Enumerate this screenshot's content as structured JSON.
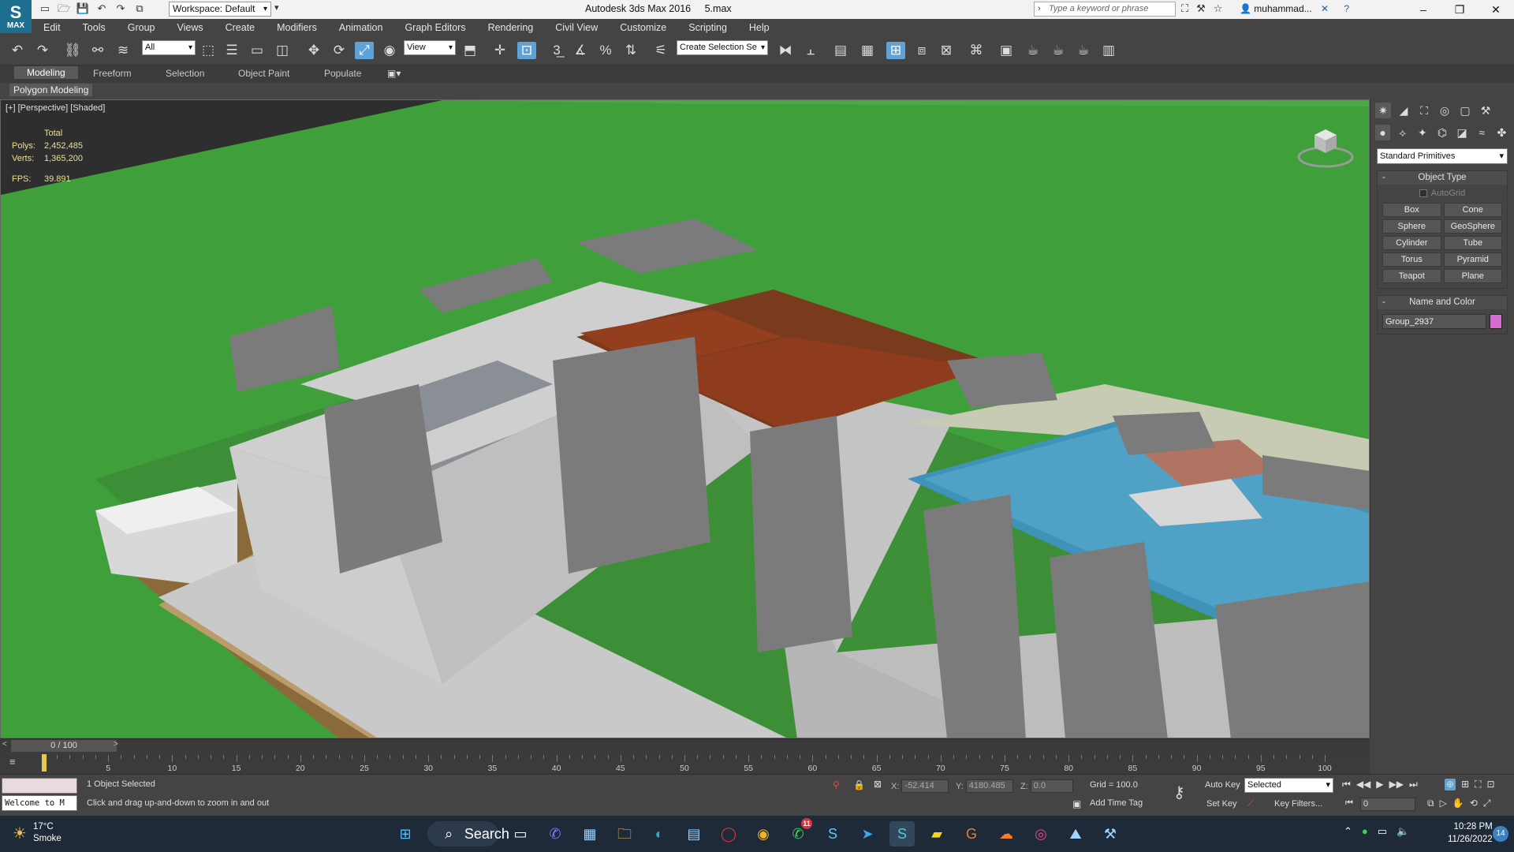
{
  "app": {
    "logo_text": "MAX",
    "workspace": "Workspace: Default",
    "title": "Autodesk 3ds Max 2016",
    "filename": "5.max",
    "search_placeholder": "Type a keyword or phrase",
    "user": "muhammad..."
  },
  "menu": [
    "Edit",
    "Tools",
    "Group",
    "Views",
    "Create",
    "Modifiers",
    "Animation",
    "Graph Editors",
    "Rendering",
    "Civil View",
    "Customize",
    "Scripting",
    "Help"
  ],
  "toolbar": {
    "filter": "All",
    "ref_coord": "View",
    "selection_set": "Create Selection Se"
  },
  "ribbon": {
    "tabs": [
      "Modeling",
      "Freeform",
      "Selection",
      "Object Paint",
      "Populate"
    ],
    "active_tab": "Modeling",
    "subpanel": "Polygon Modeling"
  },
  "viewport": {
    "label": "[+] [Perspective] [Shaded]",
    "stats_header": "Total",
    "polys_label": "Polys:",
    "polys": "2,452,485",
    "verts_label": "Verts:",
    "verts": "1,365,200",
    "fps_label": "FPS:",
    "fps": "39.891"
  },
  "command_panel": {
    "category": "Standard Primitives",
    "object_type_title": "Object Type",
    "autogrid": "AutoGrid",
    "primitives": [
      "Box",
      "Cone",
      "Sphere",
      "GeoSphere",
      "Cylinder",
      "Tube",
      "Torus",
      "Pyramid",
      "Teapot",
      "Plane"
    ],
    "name_color_title": "Name and Color",
    "object_name": "Group_2937",
    "object_color": "#d66bd0"
  },
  "timeline": {
    "frame_display": "0 / 100",
    "ticks": [
      "5",
      "10",
      "15",
      "20",
      "25",
      "30",
      "35",
      "40",
      "45",
      "50",
      "55",
      "60",
      "65",
      "70",
      "75",
      "80",
      "85",
      "90",
      "95",
      "100"
    ]
  },
  "status": {
    "maxscript_text": "Welcome to M",
    "selection": "1 Object Selected",
    "prompt": "Click and drag up-and-down to zoom in and out",
    "x_label": "X:",
    "x_value": "-52.414",
    "y_label": "Y:",
    "y_value": "4180.485",
    "z_label": "Z:",
    "z_value": "0.0",
    "grid": "Grid = 100.0",
    "add_time_tag": "Add Time Tag",
    "auto_key": "Auto Key",
    "set_key": "Set Key",
    "key_mode": "Selected",
    "key_filters": "Key Filters...",
    "current_frame": "0"
  },
  "taskbar": {
    "temp": "17°C",
    "weather": "Smoke",
    "search": "Search",
    "time": "10:28 PM",
    "date": "11/26/2022",
    "notifications": "14",
    "whatsapp_badge": "11"
  }
}
